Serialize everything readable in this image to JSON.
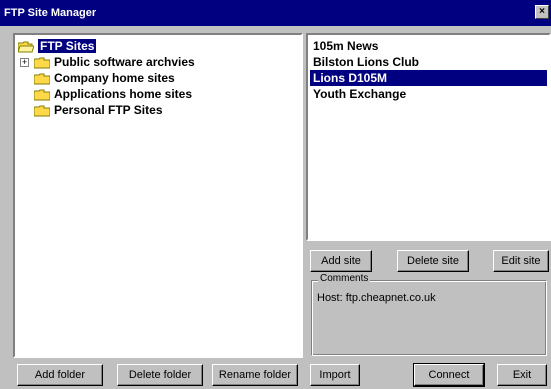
{
  "window": {
    "title": "FTP Site Manager",
    "close_label": "×"
  },
  "tree": {
    "root": {
      "label": "FTP Sites",
      "selected": true
    },
    "folders": [
      {
        "label": "Public software archvies",
        "has_children": true,
        "expander": "+"
      },
      {
        "label": "Company home sites",
        "has_children": false
      },
      {
        "label": "Applications home sites",
        "has_children": false
      },
      {
        "label": "Personal FTP Sites",
        "has_children": false
      }
    ]
  },
  "sites": {
    "items": [
      {
        "label": "105m News",
        "selected": false
      },
      {
        "label": "Bilston Lions Club",
        "selected": false
      },
      {
        "label": "Lions D105M",
        "selected": true
      },
      {
        "label": "Youth Exchange",
        "selected": false
      }
    ]
  },
  "site_buttons": {
    "add": "Add site",
    "delete": "Delete site",
    "edit": "Edit site"
  },
  "comments": {
    "label": "Comments",
    "text": "Host: ftp.cheapnet.co.uk"
  },
  "folder_buttons": {
    "add": "Add folder",
    "delete": "Delete folder",
    "rename": "Rename folder"
  },
  "footer_buttons": {
    "import": "Import",
    "connect": "Connect",
    "exit": "Exit"
  },
  "colors": {
    "titlebar": "#000080",
    "selection": "#000080",
    "face": "#c0c0c0",
    "folder": "#ffd84a"
  },
  "icons": {
    "folder": "folder-icon",
    "open_folder": "open-folder-icon",
    "expander": "expand-plus-icon"
  }
}
